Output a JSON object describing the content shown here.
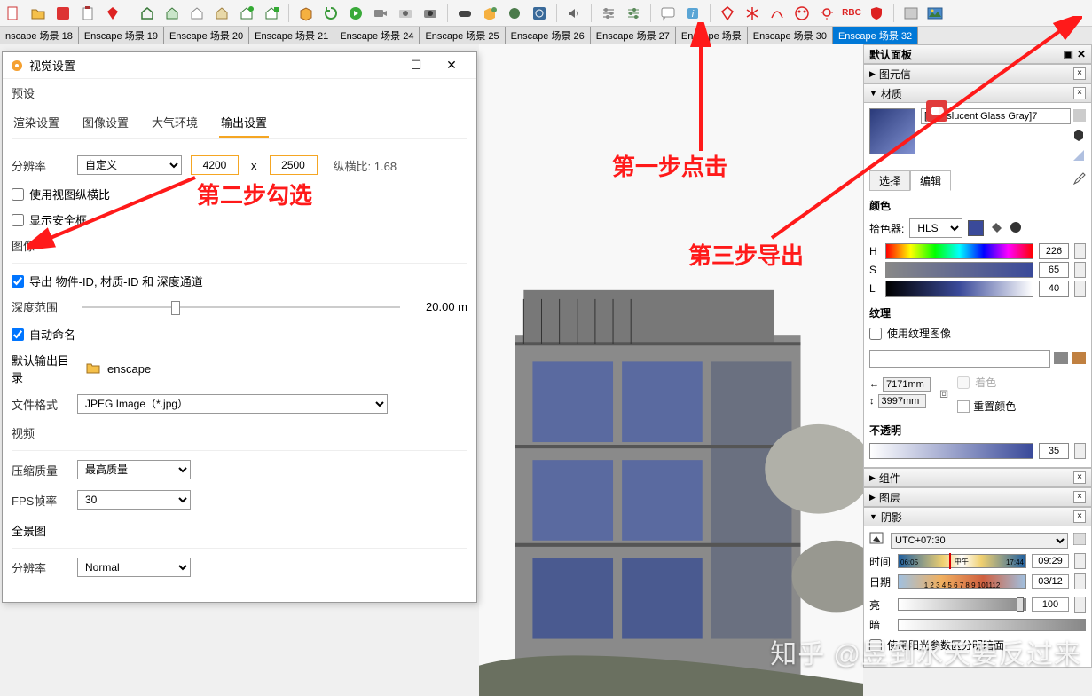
{
  "toolbar_icons": [
    "new",
    "open",
    "save",
    "clipboard",
    "ruby",
    "house1",
    "house2",
    "house3",
    "house4",
    "house5",
    "house6",
    "box1",
    "refresh",
    "play",
    "video",
    "camera1",
    "camera2",
    "goggles",
    "cloud",
    "brush",
    "settings-icon",
    "speaker",
    "sliders1",
    "sliders2",
    "chat",
    "info",
    "gem-red",
    "snow",
    "curve",
    "palette",
    "bulb",
    "rbc",
    "shield",
    "pic",
    "export-img"
  ],
  "scene_tabs": [
    "nscape 场景 18",
    "Enscape 场景 19",
    "Enscape 场景 20",
    "Enscape 场景 21",
    "Enscape 场景 24",
    "Enscape 场景 25",
    "Enscape 场景 26",
    "Enscape 场景 27",
    "Enscape 场景",
    "Enscape 场景 30",
    "Enscape 场景 32"
  ],
  "scene_tab_active": 10,
  "dialog": {
    "title": "视觉设置",
    "preset": "预设",
    "tabs": [
      "渲染设置",
      "图像设置",
      "大气环境",
      "输出设置"
    ],
    "tab_active": 3,
    "resolution_label": "分辨率",
    "resolution_mode": "自定义",
    "width": "4200",
    "height": "2500",
    "aspect_label": "纵横比:",
    "aspect_value": "1.68",
    "use_viewport_aspect": "使用视图纵横比",
    "show_safe_frame": "显示安全框",
    "image_label": "图像",
    "export_ids_label": "导出 物件-ID, 材质-ID 和 深度通道",
    "depth_label": "深度范围",
    "depth_value": "20.00 m",
    "auto_name": "自动命名",
    "default_dir_label": "默认输出目录",
    "default_dir_value": "enscape",
    "file_format_label": "文件格式",
    "file_format_value": "JPEG Image（*.jpg）",
    "video_label": "视频",
    "compress_label": "压缩质量",
    "compress_value": "最高质量",
    "fps_label": "FPS帧率",
    "fps_value": "30",
    "pano_label": "全景图",
    "pano_res_label": "分辨率",
    "pano_res_value": "Normal"
  },
  "right": {
    "default_panel": "默认面板",
    "elem_info": "图元信",
    "material": "材质",
    "mat_name": "[Translucent Glass Gray]7",
    "select_tab": "选择",
    "edit_tab": "编辑",
    "color_label": "颜色",
    "picker_label": "拾色器:",
    "picker_mode": "HLS",
    "h": "H",
    "h_val": "226",
    "s": "S",
    "s_val": "65",
    "l": "L",
    "l_val": "40",
    "texture_label": "纹理",
    "use_texture": "使用纹理图像",
    "dim_w": "7171mm",
    "dim_h": "3997mm",
    "colorize": "着色",
    "reset_color": "重置颜色",
    "opacity_label": "不透明",
    "opacity_val": "35",
    "component": "组件",
    "layer": "图层",
    "shadow": "阴影",
    "tz": "UTC+07:30",
    "time_label": "时间",
    "time_lo": "06:05",
    "time_mid": "中午",
    "time_hi": "17:44",
    "time_val": "09:29",
    "date_label": "日期",
    "date_ticks": "1 2 3 4 5 6 7 8 9 101112",
    "date_val": "03/12",
    "bright_label": "亮",
    "bright_val": "100",
    "dark_label": "暗",
    "sun_param": "使用阳光参数区分明暗面"
  },
  "annotations": {
    "step1": "第一步点击",
    "step2": "第二步勾选",
    "step3": "第三步导出"
  },
  "watermark": "知乎 @昱到水天要反过来"
}
